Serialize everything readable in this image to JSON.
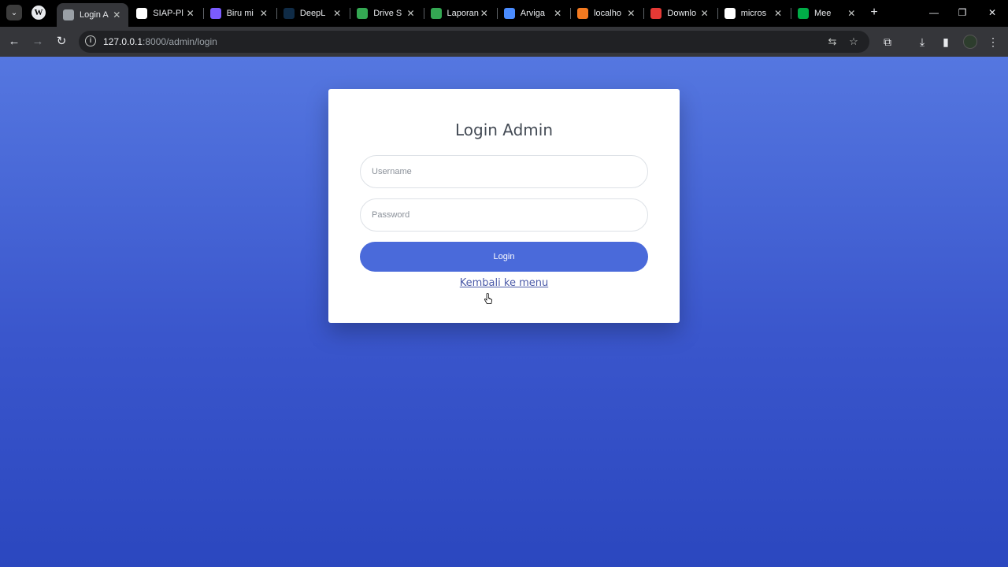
{
  "browser": {
    "tabs": [
      {
        "title": "Login A",
        "favicon": "globe-icon",
        "color": "#9aa0a6",
        "active": true
      },
      {
        "title": "SIAP-Pl",
        "favicon": "siap-icon",
        "color": "#ffffff"
      },
      {
        "title": "Biru mi",
        "favicon": "shield-icon",
        "color": "#7b5cff"
      },
      {
        "title": "DeepL",
        "favicon": "deepl-icon",
        "color": "#0f2b46"
      },
      {
        "title": "Drive S",
        "favicon": "drive-icon",
        "color": "#34a853"
      },
      {
        "title": "Laporan",
        "favicon": "drive-icon",
        "color": "#34a853"
      },
      {
        "title": "Arviga",
        "favicon": "arviga-icon",
        "color": "#4a8cff"
      },
      {
        "title": "localho",
        "favicon": "xampp-icon",
        "color": "#f47a20"
      },
      {
        "title": "Downlo",
        "favicon": "heart-icon",
        "color": "#e53935"
      },
      {
        "title": "micros",
        "favicon": "google-icon",
        "color": "#ffffff"
      },
      {
        "title": "Mee",
        "favicon": "meet-icon",
        "color": "#00ac47"
      }
    ],
    "url_host": "127.0.0.1",
    "url_rest": ":8000/admin/login"
  },
  "login": {
    "title": "Login Admin",
    "username_placeholder": "Username",
    "password_placeholder": "Password",
    "submit_label": "Login",
    "back_link": "Kembali ke menu"
  },
  "colors": {
    "accent": "#4a6ada",
    "background_top": "#5577e0",
    "background_bottom": "#2b47bf"
  }
}
